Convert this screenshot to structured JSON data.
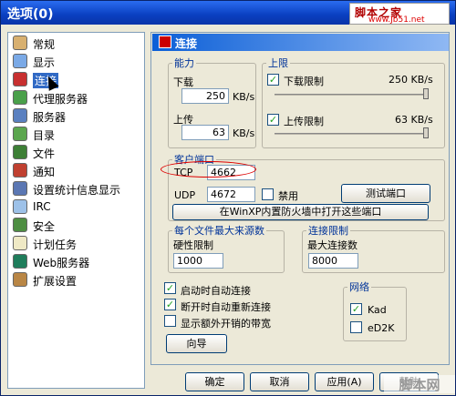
{
  "window": {
    "title": "选项(0)",
    "watermark_top": "脚本之家",
    "watermark_url": "www.Jb51.net",
    "watermark_bottom": "脚本网"
  },
  "sidebar": {
    "items": [
      {
        "label": "常规",
        "icon": "tools-icon"
      },
      {
        "label": "显示",
        "icon": "monitor-icon"
      },
      {
        "label": "连接",
        "icon": "connection-icon",
        "selected": true
      },
      {
        "label": "代理服务器",
        "icon": "proxy-icon"
      },
      {
        "label": "服务器",
        "icon": "server-icon"
      },
      {
        "label": "目录",
        "icon": "folder-icon"
      },
      {
        "label": "文件",
        "icon": "file-icon"
      },
      {
        "label": "通知",
        "icon": "notification-icon"
      },
      {
        "label": "设置统计信息显示",
        "icon": "stats-icon"
      },
      {
        "label": "IRC",
        "icon": "irc-icon"
      },
      {
        "label": "安全",
        "icon": "security-icon"
      },
      {
        "label": "计划任务",
        "icon": "calendar-icon"
      },
      {
        "label": "Web服务器",
        "icon": "web-icon"
      },
      {
        "label": "扩展设置",
        "icon": "extensions-icon"
      }
    ]
  },
  "panel": {
    "title": "连接"
  },
  "capacity": {
    "legend": "能力",
    "download_label": "下载",
    "download_value": "250",
    "upload_label": "上传",
    "upload_value": "63",
    "unit": "KB/s"
  },
  "limits": {
    "legend": "上限",
    "download_limit_label": "下载限制",
    "download_limit_value": "250 KB/s",
    "upload_limit_label": "上传限制",
    "upload_limit_value": "63 KB/s",
    "download_slider": 1.0,
    "upload_slider": 1.0
  },
  "client_port": {
    "legend": "客户端口",
    "tcp_label": "TCP",
    "tcp_value": "4662",
    "udp_label": "UDP",
    "udp_value": "4672",
    "disable_label": "禁用",
    "test_button": "测试端口",
    "firewall_button": "在WinXP内置防火墙中打开这些端口"
  },
  "sources": {
    "legend": "每个文件最大来源数",
    "hard_limit_label": "硬性限制",
    "hard_limit_value": "1000"
  },
  "connections": {
    "legend": "连接限制",
    "max_label": "最大连接数",
    "max_value": "8000"
  },
  "options": {
    "auto_connect": "启动时自动连接",
    "auto_reconnect": "断开时自动重新连接",
    "show_overhead": "显示额外开销的带宽",
    "wizard_button": "向导"
  },
  "network": {
    "legend": "网络",
    "kad": "Kad",
    "ed2k": "eD2K"
  },
  "buttons": {
    "ok": "确定",
    "cancel": "取消",
    "apply": "应用(A)",
    "help": "帮助"
  },
  "colors": {
    "title_blue": "#0a3fc0",
    "selected": "#316ac5",
    "highlight_red": "#d00000"
  }
}
